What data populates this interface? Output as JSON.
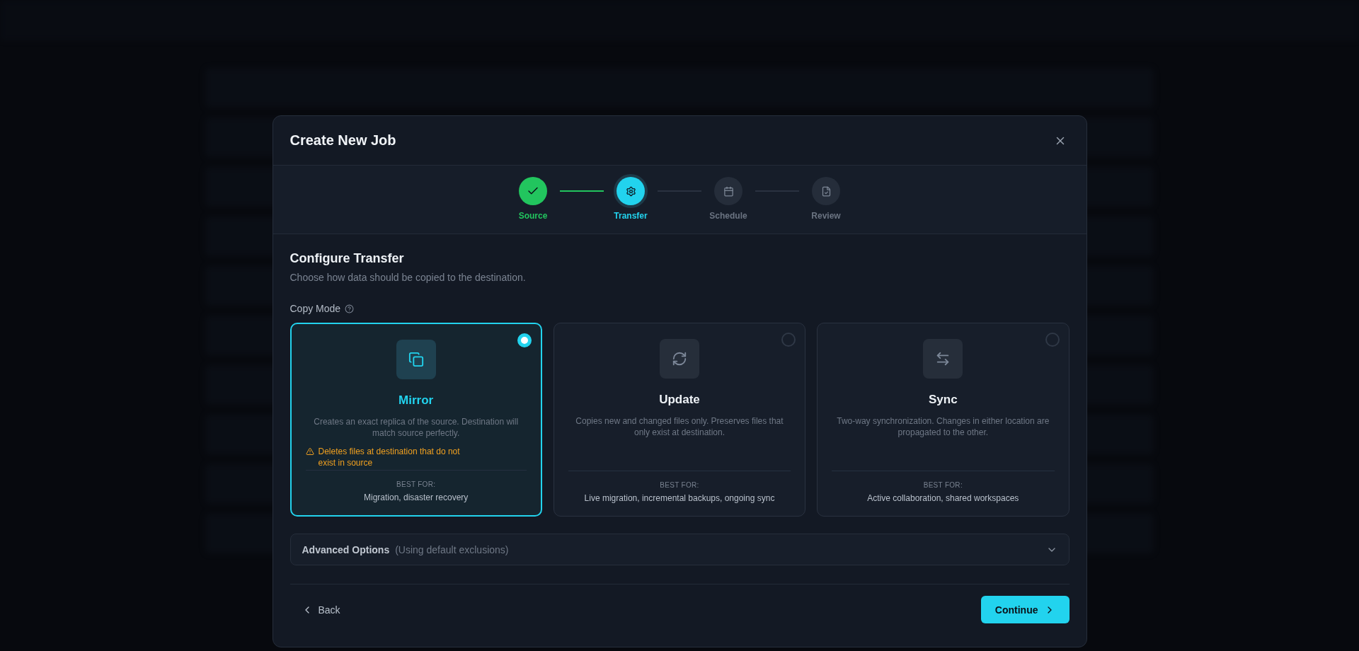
{
  "dialog": {
    "title": "Create New Job",
    "steps": [
      {
        "label": "Source",
        "completed": true,
        "selected": false
      },
      {
        "label": "Transfer",
        "completed": false,
        "selected": true
      },
      {
        "label": "Schedule",
        "completed": false,
        "selected": false
      },
      {
        "label": "Review",
        "completed": false,
        "selected": false
      }
    ],
    "section_title": "Configure Transfer",
    "section_subtitle": "Choose how data should be copied to the destination.",
    "copy_mode_label": "Copy Mode",
    "modes": [
      {
        "kind": "mirror",
        "title": "Mirror",
        "description": "Creates an exact replica of the source. Destination will match source perfectly.",
        "warning": "Deletes files at destination that do not exist in source",
        "best_for_label": "BEST FOR:",
        "best_for": "Migration, disaster recovery",
        "selected": true
      },
      {
        "kind": "update",
        "title": "Update",
        "description": "Copies new and changed files only. Preserves files that only exist at destination.",
        "best_for_label": "BEST FOR:",
        "best_for": "Live migration, incremental backups, ongoing sync",
        "selected": false
      },
      {
        "kind": "sync",
        "title": "Sync",
        "description": "Two-way synchronization. Changes in either location are propagated to the other.",
        "best_for_label": "BEST FOR:",
        "best_for": "Active collaboration, shared workspaces",
        "selected": false
      }
    ],
    "advanced": {
      "label": "Advanced Options",
      "note": "(Using default exclusions)",
      "expanded": false
    },
    "back_button": "Back",
    "continue_button": "Continue"
  }
}
